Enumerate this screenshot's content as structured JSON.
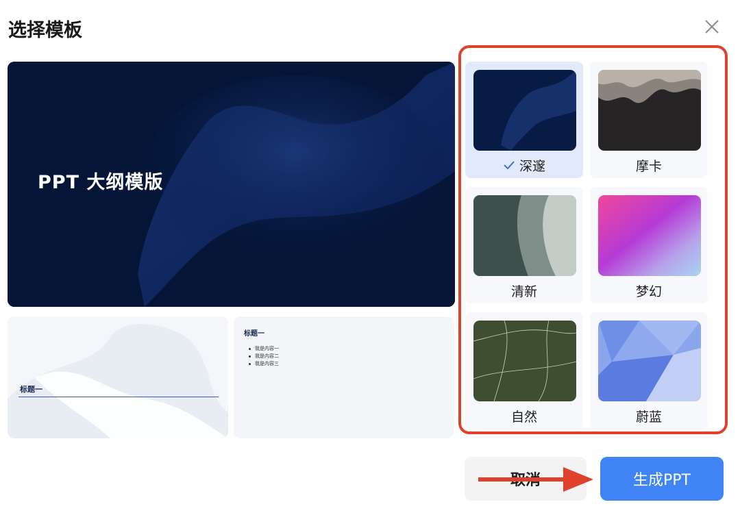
{
  "dialog": {
    "title": "选择模板"
  },
  "preview": {
    "main_title": "PPT 大纲模版",
    "section_title": "标题一",
    "content_title": "标题一",
    "content_items": [
      "我是内容一",
      "我是内容二",
      "我是内容三"
    ]
  },
  "templates": [
    {
      "label": "深邃",
      "selected": true
    },
    {
      "label": "摩卡",
      "selected": false
    },
    {
      "label": "清新",
      "selected": false
    },
    {
      "label": "梦幻",
      "selected": false
    },
    {
      "label": "自然",
      "selected": false
    },
    {
      "label": "蔚蓝",
      "selected": false
    }
  ],
  "footer": {
    "cancel_label": "取消",
    "generate_label": "生成PPT"
  },
  "icons": [
    "close-icon",
    "check-icon",
    "arrow-right-icon"
  ],
  "colors": {
    "accent": "#3f83f5",
    "highlight_frame": "#e0412c",
    "annotation_arrow": "#e0412c",
    "selected_card": "#e2e9fb"
  }
}
